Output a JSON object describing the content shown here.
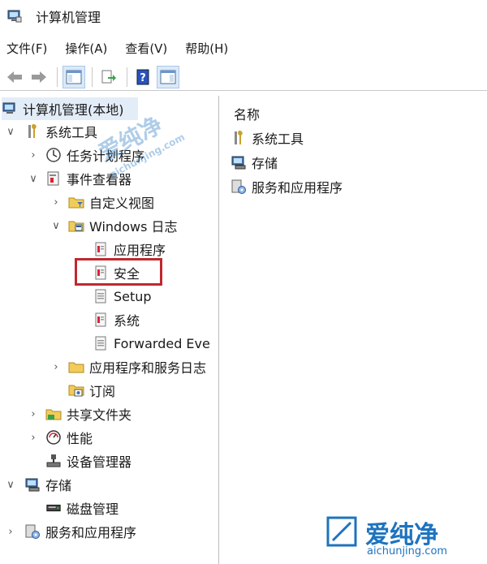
{
  "window": {
    "title": "计算机管理"
  },
  "menu": [
    "文件(F)",
    "操作(A)",
    "查看(V)",
    "帮助(H)"
  ],
  "toolbar": [
    "back-icon",
    "forward-icon",
    "show-hide-tree-icon",
    "export-list-icon",
    "help-icon",
    "action-pane-icon"
  ],
  "tree": {
    "root": "计算机管理(本地)",
    "system_tools": "系统工具",
    "task_scheduler": "任务计划程序",
    "event_viewer": "事件查看器",
    "custom_views": "自定义视图",
    "windows_logs": "Windows 日志",
    "application": "应用程序",
    "security": "安全",
    "setup": "Setup",
    "system": "系统",
    "forwarded": "Forwarded Eve",
    "app_service_logs": "应用程序和服务日志",
    "subscriptions": "订阅",
    "shared_folders": "共享文件夹",
    "performance": "性能",
    "device_manager": "设备管理器",
    "storage": "存储",
    "disk_management": "磁盘管理",
    "services_apps": "服务和应用程序"
  },
  "right_pane": {
    "column_header": "名称",
    "items": [
      "系统工具",
      "存储",
      "服务和应用程序"
    ]
  },
  "watermark": {
    "cn": "爱纯净",
    "url": "aichunjing.com"
  },
  "colors": {
    "highlight": "#c0282d",
    "selection": "#e3edf8",
    "watermark": "#1e73be"
  }
}
